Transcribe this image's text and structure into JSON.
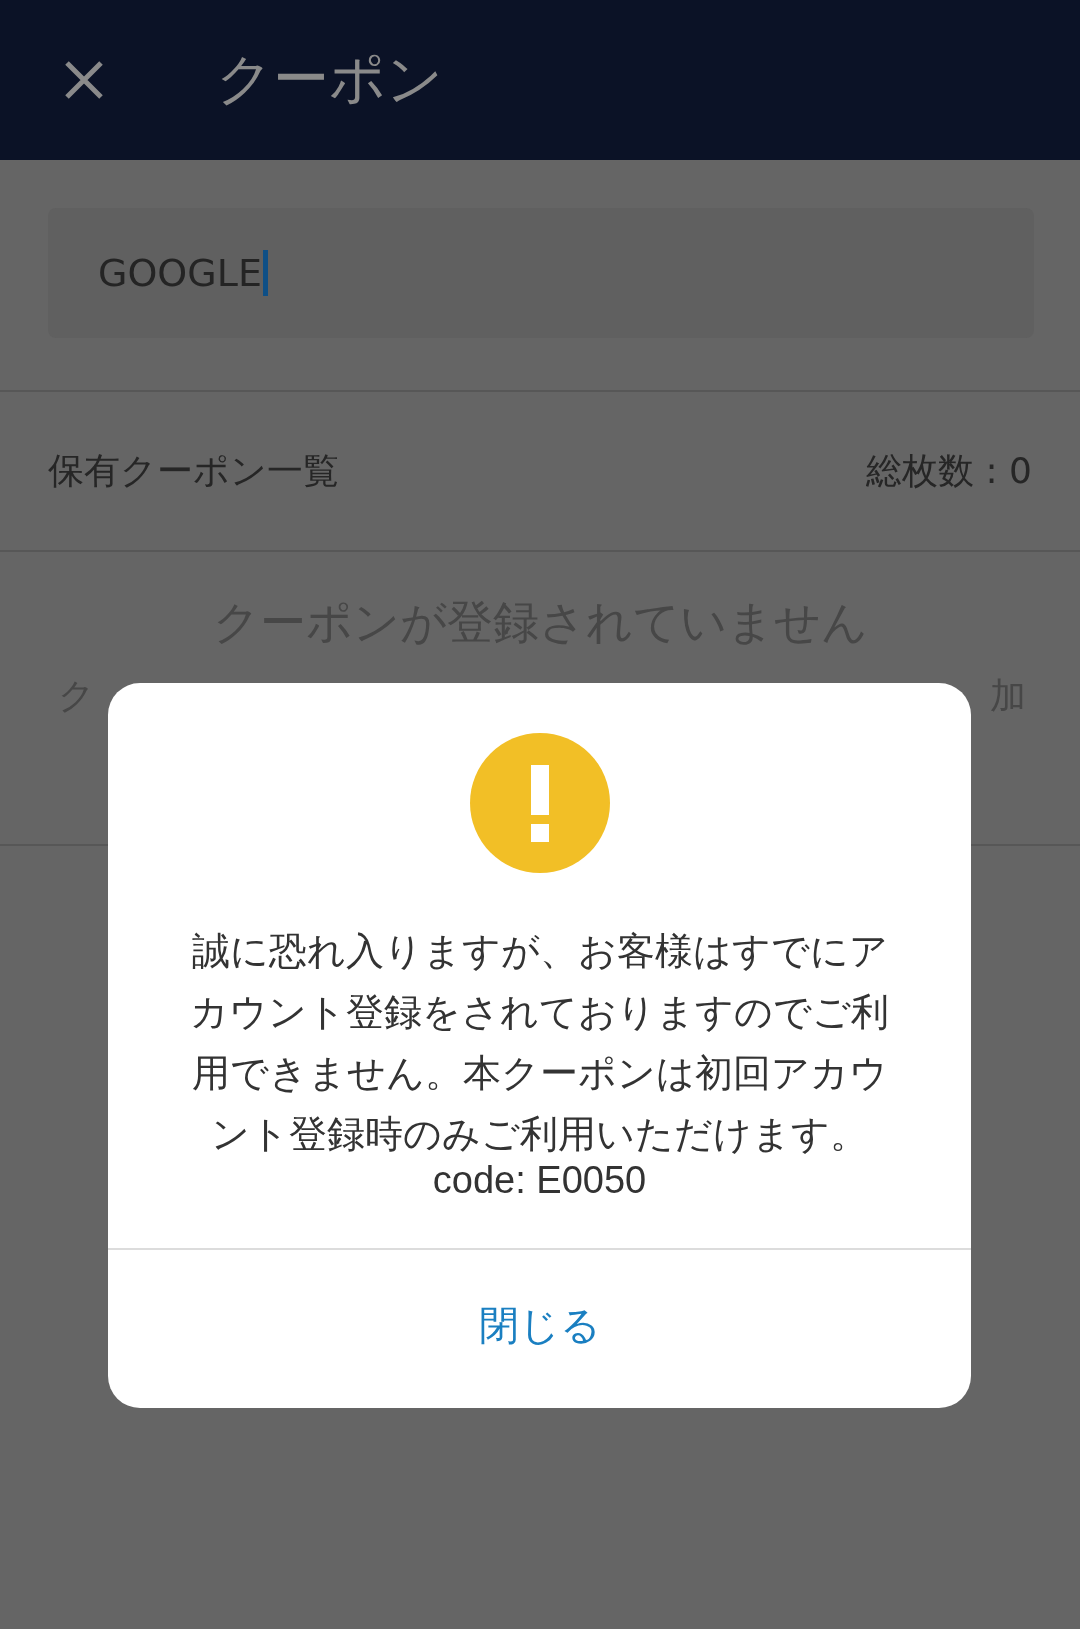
{
  "header": {
    "title": "クーポン"
  },
  "coupon_input": {
    "value": "GOOGLE"
  },
  "list_header": {
    "title": "保有クーポン一覧",
    "total": "総枚数 : 0"
  },
  "empty_state": {
    "message": "クーポンが登録されていません",
    "hint_left": "ク",
    "hint_right": "加"
  },
  "dialog": {
    "message": "誠に恐れ入りますが、お客様はすでにアカウント登録をされておりますのでご利用できません。本クーポンは初回アカウント登録時のみご利用いただけます。",
    "code": "code: E0050",
    "button": "閉じる"
  }
}
